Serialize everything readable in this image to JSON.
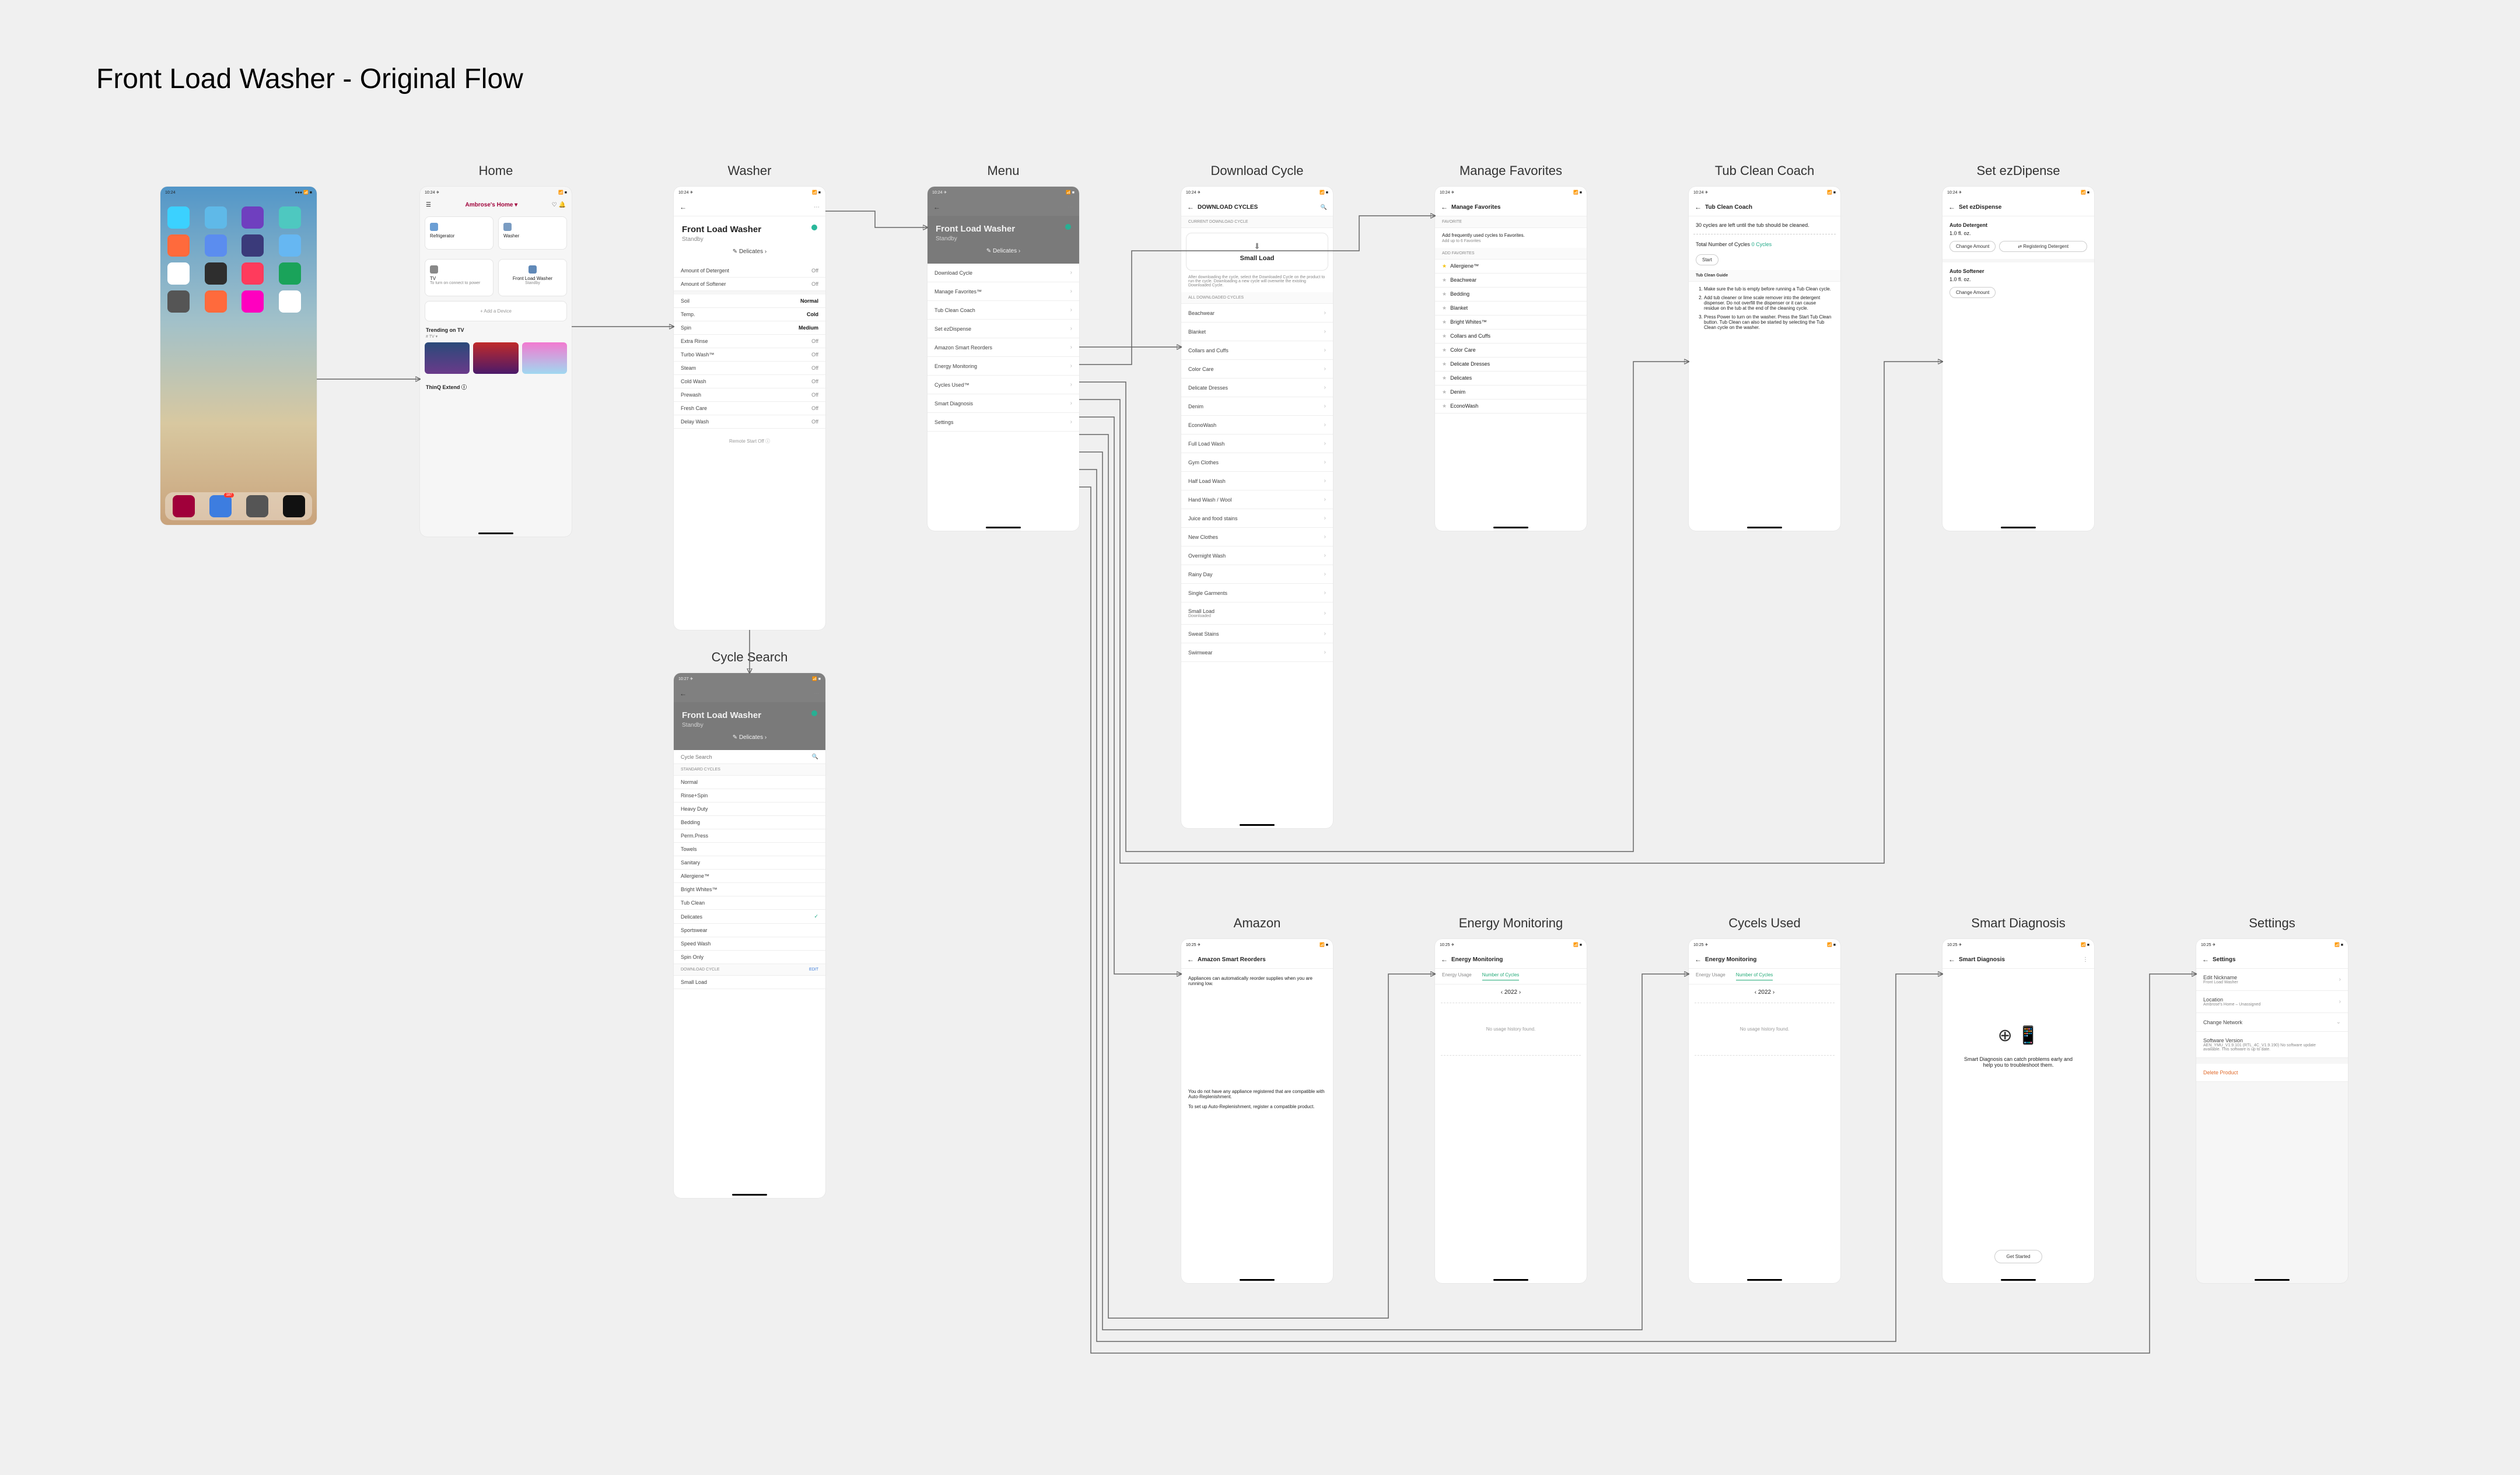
{
  "page_title": "Front Load Washer - Original Flow",
  "labels": {
    "home": "Home",
    "washer": "Washer",
    "menu": "Menu",
    "download_cycle": "Download Cycle",
    "manage_fav": "Manage Favorites",
    "tub_clean": "Tub Clean Coach",
    "ezdispense": "Set ezDipense",
    "cycle_search": "Cycle Search",
    "amazon": "Amazon",
    "energy": "Energy Monitoring",
    "cycles_used": "Cycels Used",
    "smart_diag": "Smart Diagnosis",
    "settings": "Settings"
  },
  "status_time": "10:24 ✈",
  "status_time2": "10:27 ✈",
  "status_time3": "10:25 ✈",
  "ios_dock_badge": "187",
  "thinq": {
    "home_name": "Ambrose's Home ▾",
    "tiles": [
      {
        "name": "Refrigerator",
        "sub": ""
      },
      {
        "name": "Washer",
        "sub": ""
      }
    ],
    "tv": "TV",
    "washer_tile_title": "Front Load Washer",
    "washer_tile_sub": "Standby",
    "add_device": "+  Add a Device",
    "trending": "Trending on TV",
    "trending_sub": "# TV ▾",
    "extend": "ThinQ Extend ⓘ"
  },
  "washer": {
    "title": "Front Load Washer",
    "sub": "Standby",
    "cycle": "✎ Delicates ›",
    "rows": [
      {
        "k": "Amount of Detergent",
        "v": "Off"
      },
      {
        "k": "Amount of Softener",
        "v": "Off"
      }
    ],
    "opts": [
      {
        "k": "Soil",
        "v": "Normal",
        "b": true
      },
      {
        "k": "Temp.",
        "v": "Cold",
        "b": true
      },
      {
        "k": "Spin",
        "v": "Medium",
        "b": true
      },
      {
        "k": "Extra Rinse",
        "v": "Off"
      },
      {
        "k": "Turbo Wash™",
        "v": "Off"
      },
      {
        "k": "Steam",
        "v": "Off"
      },
      {
        "k": "Cold Wash",
        "v": "Off"
      },
      {
        "k": "Prewash",
        "v": "Off"
      },
      {
        "k": "Fresh Care",
        "v": "Off"
      },
      {
        "k": "Delay Wash",
        "v": "Off"
      }
    ],
    "remote": "Remote Start Off ⓘ"
  },
  "menu": {
    "items": [
      "Download Cycle",
      "Manage Favorites™",
      "Tub Clean Coach",
      "Set ezDispense",
      "Amazon Smart Reorders",
      "Energy Monitoring",
      "Cycles Used™",
      "Smart Diagnosis",
      "Settings"
    ]
  },
  "cycle_search": {
    "placeholder": "Cycle Search",
    "hdr_std": "STANDARD CYCLES",
    "std": [
      "Normal",
      "Rinse+Spin",
      "Heavy Duty",
      "Bedding",
      "Perm.Press",
      "Towels",
      "Sanitary",
      "Allergiene™",
      "Bright Whites™",
      "Tub Clean",
      "Delicates",
      "Sportswear",
      "Speed Wash",
      "Spin Only"
    ],
    "hdr_dl": "Download Cycle",
    "dl_edit": "Edit",
    "dl_item": "Small Load"
  },
  "download": {
    "nav": "DOWNLOAD CYCLES",
    "hdr_cur": "CURRENT DOWNLOAD CYCLE",
    "current": "Small Load",
    "desc": "After downloading the cycle, select the Downloaded Cycle on the product to run the cycle. Downloading a new cycle will overwrite the existing Downloaded Cycle.",
    "hdr_all": "ALL DOWNLOADED CYCLES",
    "cycles": [
      "Beachwear",
      "Blanket",
      "Collars and Cuffs",
      "Color Care",
      "Delicate Dresses",
      "Denim",
      "EconoWash",
      "Full Load Wash",
      "Gym Clothes",
      "Half Load Wash",
      "Hand Wash / Wool",
      "Juice and food stains",
      "New Clothes",
      "Overnight Wash",
      "Rainy Day",
      "Single Garments",
      "Small Load",
      "Sweat Stains",
      "Swimwear"
    ],
    "small_load_sub": "Downloaded"
  },
  "favorites": {
    "nav": "Manage Favorites",
    "hdr_f": "FAVORITE",
    "note": "Add frequently used cycles to Favorites.",
    "note2": "Add up to 6 Favorites",
    "hdr_add": "ADD FAVORITES",
    "list": [
      {
        "name": "Allergiene™",
        "on": true
      },
      {
        "name": "Beachwear",
        "on": false
      },
      {
        "name": "Bedding",
        "on": false
      },
      {
        "name": "Blanket",
        "on": false
      },
      {
        "name": "Bright Whites™",
        "on": false
      },
      {
        "name": "Collars and Cuffs",
        "on": false
      },
      {
        "name": "Color Care",
        "on": false
      },
      {
        "name": "Delicate Dresses",
        "on": false
      },
      {
        "name": "Delicates",
        "on": false
      },
      {
        "name": "Denim",
        "on": false
      },
      {
        "name": "EconoWash",
        "on": false
      }
    ]
  },
  "tubclean": {
    "nav": "Tub Clean Coach",
    "lead": "30 cycles are left until the tub should be cleaned.",
    "total_l": "Total Number of Cycles",
    "total_v": "0 Cycles",
    "start": "Start",
    "guide_h": "Tub Clean Guide",
    "guide": [
      "Make sure the tub is empty before running a Tub Clean cycle.",
      "Add tub cleaner or lime scale remover into the detergent dispenser. Do not overfill the dispenser or it can cause residue on the tub at the end of the cleaning cycle.",
      "Press Power to turn on the washer. Press the Start Tub Clean button. Tub Clean can also be started by selecting the Tub Clean cycle on the washer."
    ]
  },
  "ezd": {
    "nav": "Set ezDispense",
    "d_h": "Auto Detergent",
    "d_v": "1.0 fl. oz.",
    "btn1": "Change Amount",
    "btn2": "Registering Detergent",
    "s_h": "Auto Softener",
    "s_v": "1.0 fl. oz.",
    "btn3": "Change Amount"
  },
  "amazon": {
    "nav": "Amazon Smart Reorders",
    "p1": "Appliances can automatically reorder supplies when you are running low.",
    "p2": "You do not have any appliance registered that are compatible with Auto-Replenishment.",
    "p3": "To set up Auto-Replenishment, register a compatible product."
  },
  "energy": {
    "nav": "Energy Monitoring",
    "tab1": "Energy Usage",
    "tab2": "Number of Cycles",
    "year": "2022",
    "empty": "No usage history found."
  },
  "diag": {
    "nav": "Smart Diagnosis",
    "msg": "Smart Diagnosis can catch problems early and help you to troubleshoot them.",
    "btn": "Get Started"
  },
  "settings": {
    "nav": "Settings",
    "r1": "Edit Nickname",
    "r1s": "Front Load Washer",
    "r2": "Location",
    "r2s": "Ambrose's Home – Unassigned",
    "r3": "Change Network",
    "r3s": "",
    "r4": "Software Version",
    "r4s": "AEN_YMU_V1.9.101 (RTL_4C_V1.9.190)  No software update available. This software is up to date.",
    "r5": "Delete Product"
  }
}
